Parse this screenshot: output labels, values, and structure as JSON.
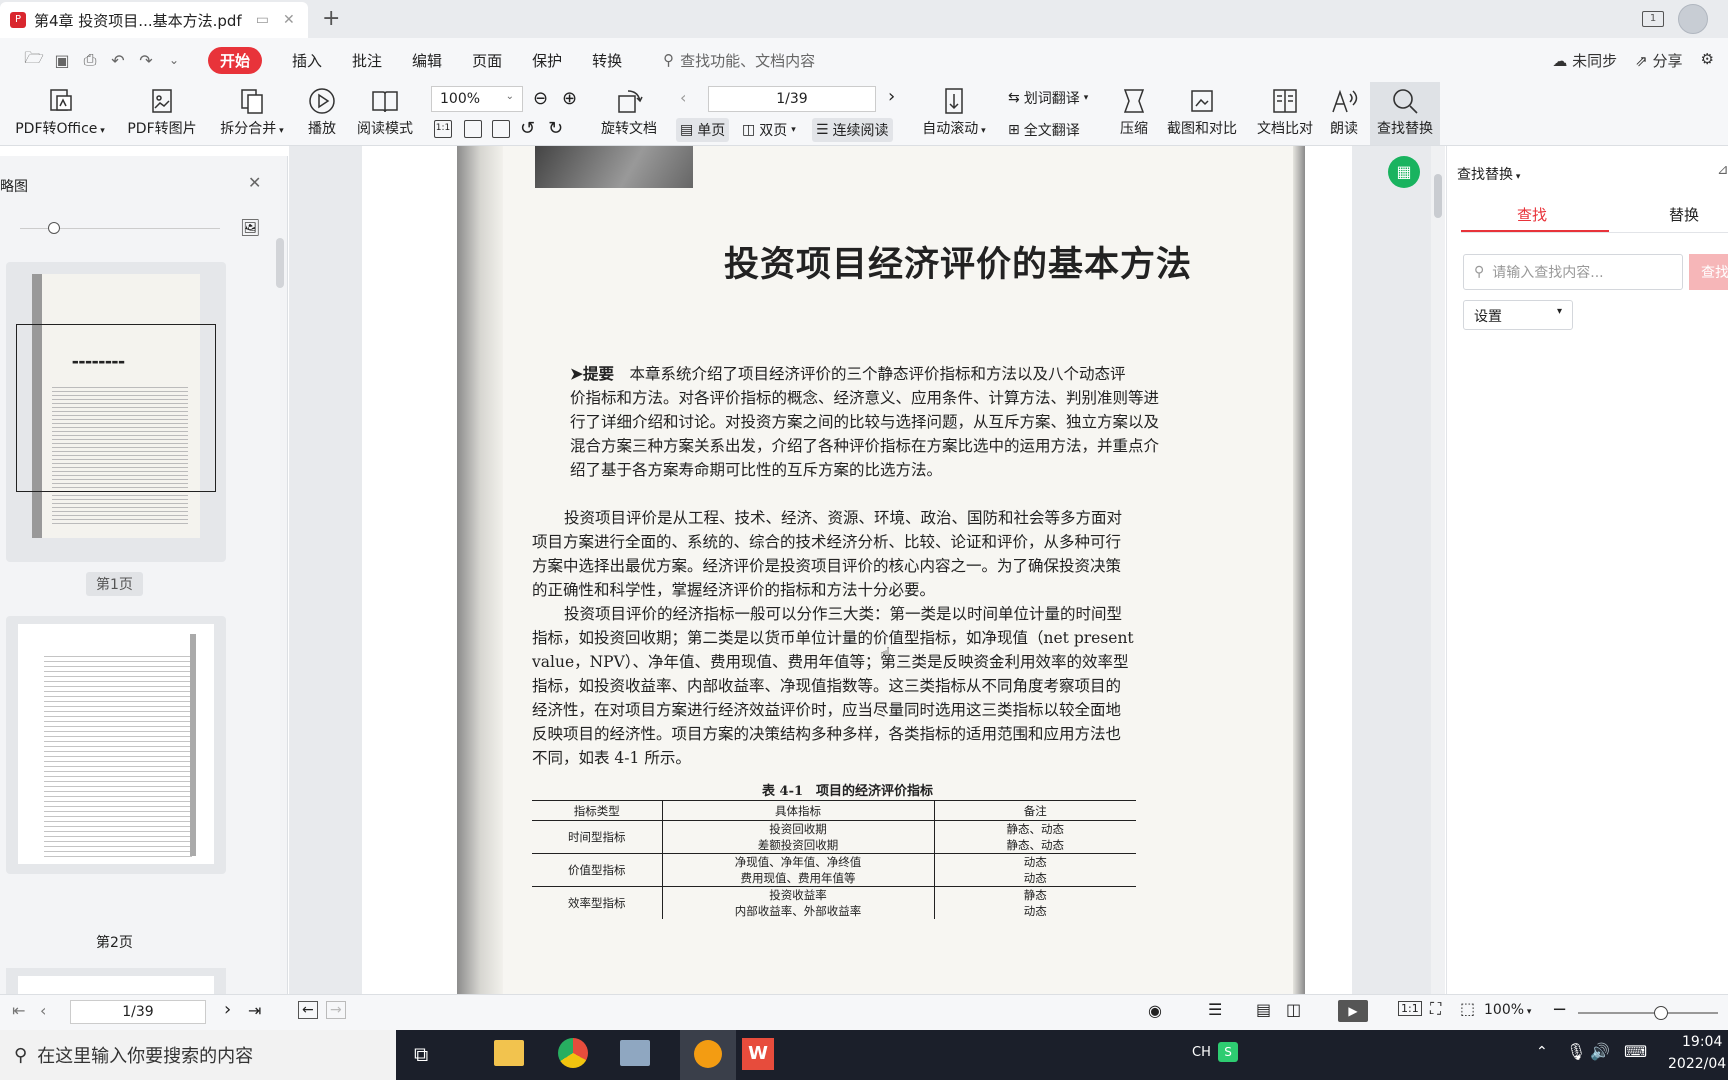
{
  "tab": {
    "title": "第4章 投资项目...基本方法.pdf"
  },
  "menu": {
    "items": [
      "开始",
      "插入",
      "批注",
      "编辑",
      "页面",
      "保护",
      "转换"
    ],
    "search_placeholder": "查找功能、文档内容",
    "sync": "未同步",
    "share": "分享"
  },
  "toolbar": {
    "pdf_to_office": "PDF转Office",
    "pdf_to_image": "PDF转图片",
    "split_merge": "拆分合并",
    "play": "播放",
    "read_mode": "阅读模式",
    "zoom": "100%",
    "rotate": "旋转文档",
    "page_indicator": "1/39",
    "single": "单页",
    "double": "双页",
    "continuous": "连续阅读",
    "auto_scroll": "自动滚动",
    "word_translate": "划词翻译",
    "full_translate": "全文翻译",
    "compress": "压缩",
    "screenshot_compare": "截图和对比",
    "doc_compare": "文档比对",
    "read_aloud": "朗读",
    "find_replace": "查找替换"
  },
  "left_panel": {
    "title": "略图",
    "page1_label": "第1页",
    "page2_label": "第2页"
  },
  "document": {
    "chapter_title": "投资项目经济评价的基本方法",
    "abstract_label": "➤提要",
    "abstract_lines": [
      "本章系统介绍了项目经济评价的三个静态评价指标和方法以及八个动态评",
      "价指标和方法。对各评价指标的概念、经济意义、应用条件、计算方法、判别准则等进",
      "行了详细介绍和讨论。对投资方案之间的比较与选择问题，从互斥方案、独立方案以及",
      "混合方案三种方案关系出发，介绍了各种评价指标在方案比选中的运用方法，并重点介",
      "绍了基于各方案寿命期可比性的互斥方案的比选方法。"
    ],
    "para1_lines": [
      "投资项目评价是从工程、技术、经济、资源、环境、政治、国防和社会等多方面对",
      "项目方案进行全面的、系统的、综合的技术经济分析、比较、论证和评价，从多种可行",
      "方案中选择出最优方案。经济评价是投资项目评价的核心内容之一。为了确保投资决策",
      "的正确性和科学性，掌握经济评价的指标和方法十分必要。"
    ],
    "para2_lines": [
      "投资项目评价的经济指标一般可以分作三大类：第一类是以时间单位计量的时间型",
      "指标，如投资回收期；第二类是以货币单位计量的价值型指标，如净现值（net present",
      "value，NPV）、净年值、费用现值、费用年值等；第三类是反映资金利用效率的效率型",
      "指标，如投资收益率、内部收益率、净现值指数等。这三类指标从不同角度考察项目的",
      "经济性，在对项目方案进行经济效益评价时，应当尽量同时选用这三类指标以较全面地",
      "反映项目的经济性。项目方案的决策结构多种多样，各类指标的适用范围和应用方法也",
      "不同，如表 4-1 所示。"
    ],
    "table_caption": "表 4-1　项目的经济评价指标",
    "table_headers": [
      "指标类型",
      "具体指标",
      "备注"
    ],
    "table_rows": [
      {
        "type": "时间型指标",
        "items": [
          "投资回收期",
          "差额投资回收期"
        ],
        "notes": [
          "静态、动态",
          "静态、动态"
        ]
      },
      {
        "type": "价值型指标",
        "items": [
          "净现值、净年值、净终值",
          "费用现值、费用年值等"
        ],
        "notes": [
          "动态",
          "动态"
        ]
      },
      {
        "type": "效率型指标",
        "items": [
          "投资收益率",
          "内部收益率、外部收益率"
        ],
        "notes": [
          "静态",
          "动态"
        ]
      }
    ]
  },
  "right_panel": {
    "title": "查找替换",
    "tab_find": "查找",
    "tab_replace": "替换",
    "search_placeholder": "请输入查找内容...",
    "search_button": "查找",
    "settings": "设置"
  },
  "statusbar": {
    "page_indicator": "1/39",
    "zoom": "100%"
  },
  "taskbar": {
    "search_placeholder": "在这里输入你要搜索的内容",
    "ime": "CH",
    "time": "19:04",
    "date": "2022/04"
  }
}
